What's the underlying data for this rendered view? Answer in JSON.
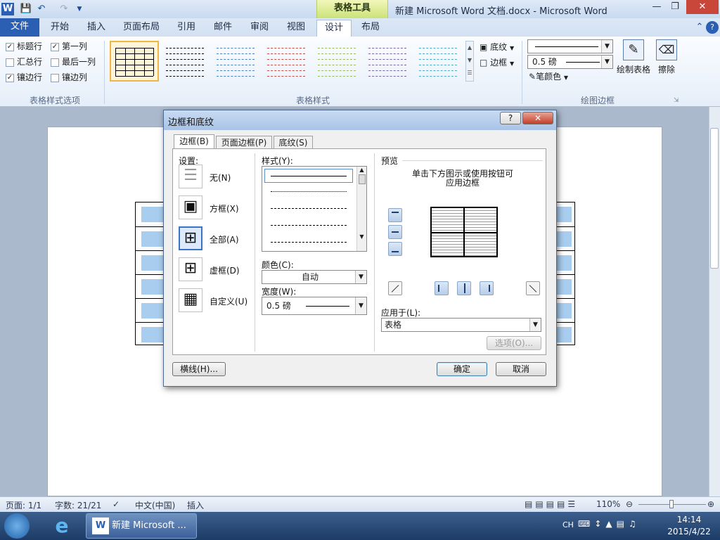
{
  "window": {
    "title": "新建 Microsoft Word 文档.docx - Microsoft Word",
    "contextual_group": "表格工具"
  },
  "ribbon": {
    "file_tab": "文件",
    "tabs": [
      "开始",
      "插入",
      "页面布局",
      "引用",
      "邮件",
      "审阅",
      "视图",
      "设计",
      "布局"
    ],
    "active_tab": "设计",
    "style_options": {
      "label": "表格样式选项",
      "checkboxes": [
        {
          "label": "标题行",
          "checked": true
        },
        {
          "label": "第一列",
          "checked": true
        },
        {
          "label": "汇总行",
          "checked": false
        },
        {
          "label": "最后一列",
          "checked": false
        },
        {
          "label": "镶边行",
          "checked": true
        },
        {
          "label": "镶边列",
          "checked": false
        }
      ]
    },
    "table_styles": {
      "label": "表格样式",
      "shading": "底纹",
      "borders": "边框",
      "thumb_colors": [
        "#000000",
        "#000000",
        "#4f81bd",
        "#c0504d",
        "#9bbb59",
        "#8064a2",
        "#4bacc6"
      ]
    },
    "draw_borders": {
      "label": "绘图边框",
      "weight": "0.5 磅",
      "pen_color": "笔颜色",
      "draw_table": "绘制表格",
      "eraser": "擦除"
    }
  },
  "dialog": {
    "title": "边框和底纹",
    "help": "?",
    "tabs": [
      "边框(B)",
      "页面边框(P)",
      "底纹(S)"
    ],
    "settings": {
      "label": "设置:",
      "items": [
        {
          "label": "无(N)",
          "selected": false
        },
        {
          "label": "方框(X)",
          "selected": false
        },
        {
          "label": "全部(A)",
          "selected": true
        },
        {
          "label": "虚框(D)",
          "selected": false
        },
        {
          "label": "自定义(U)",
          "selected": false
        }
      ]
    },
    "style_label": "样式(Y):",
    "color_label": "颜色(C):",
    "color_value": "自动",
    "width_label": "宽度(W):",
    "width_value": "0.5 磅",
    "preview_label": "预览",
    "preview_hint_1": "单击下方图示或使用按钮可",
    "preview_hint_2": "应用边框",
    "apply_to_label": "应用于(L):",
    "apply_to_value": "表格",
    "options_button": "选项(O)...",
    "horizontal_line_button": "横线(H)...",
    "ok_button": "确定",
    "cancel_button": "取消"
  },
  "statusbar": {
    "page": "页面: 1/1",
    "words": "字数: 21/21",
    "language": "中文(中国)",
    "mode": "插入",
    "zoom": "110%"
  },
  "taskbar": {
    "app_button": "新建 Microsoft ...",
    "ime": "CH",
    "time": "14:14",
    "date": "2015/4/22"
  }
}
